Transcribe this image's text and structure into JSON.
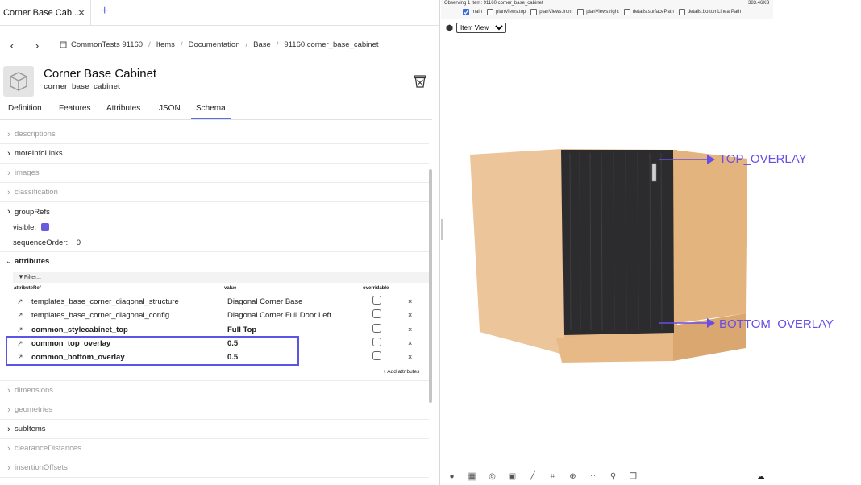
{
  "tab": {
    "title": "Corner Base Cab...",
    "close": "✕",
    "add": "+"
  },
  "breadcrumbs": [
    "CommonTests 91160",
    "Items",
    "Documentation",
    "Base",
    "91160.corner_base_cabinet"
  ],
  "item": {
    "title": "Corner Base Cabinet",
    "subtitle": "corner_base_cabinet"
  },
  "tabs": [
    "Definition",
    "Features",
    "Attributes",
    "JSON",
    "Schema"
  ],
  "active_tab": "Schema",
  "sections_top": [
    {
      "label": "descriptions",
      "state": "dim"
    },
    {
      "label": "moreInfoLinks",
      "state": "dark"
    },
    {
      "label": "images",
      "state": "dim"
    },
    {
      "label": "classification",
      "state": "dim"
    },
    {
      "label": "groupRefs",
      "state": "dark"
    }
  ],
  "visible_label": "visible:",
  "sequence": {
    "label": "sequenceOrder:",
    "value": "0"
  },
  "attributes_section": "attributes",
  "filter_placeholder": "Filter...",
  "columns": {
    "ref": "attributeRef",
    "value": "value",
    "overridable": "overridable"
  },
  "attributes": [
    {
      "ref": "templates_base_corner_diagonal_structure",
      "value": "Diagonal Corner Base",
      "bold": false
    },
    {
      "ref": "templates_base_corner_diagonal_config",
      "value": "Diagonal Corner Full Door Left",
      "bold": false
    },
    {
      "ref": "common_stylecabinet_top",
      "value": "Full Top",
      "bold": true
    },
    {
      "ref": "common_top_overlay",
      "value": "0.5",
      "bold": true
    },
    {
      "ref": "common_bottom_overlay",
      "value": "0.5",
      "bold": true
    }
  ],
  "remove_glyph": "×",
  "add_attributes": "+ Add attributes",
  "sections_bottom": [
    {
      "label": "dimensions",
      "state": "dim"
    },
    {
      "label": "geometries",
      "state": "dim"
    },
    {
      "label": "subItems",
      "state": "dark"
    },
    {
      "label": "clearanceDistances",
      "state": "dim"
    },
    {
      "label": "insertionOffsets",
      "state": "dim"
    }
  ],
  "viewer": {
    "observing": "Observing 1 item: 91160.corner_base_cabinet",
    "size": "383.46KB",
    "options": [
      {
        "label": "main",
        "checked": true
      },
      {
        "label": "planViews.top",
        "checked": false
      },
      {
        "label": "planViews.front",
        "checked": false
      },
      {
        "label": "planViews.right",
        "checked": false
      },
      {
        "label": "details.surfacePath",
        "checked": false
      },
      {
        "label": "details.bottomLinearPath",
        "checked": false
      }
    ],
    "view_select": "Item View",
    "annotations": {
      "top": "TOP_OVERLAY",
      "bottom": "BOTTOM_OVERLAY"
    }
  },
  "colors": {
    "accent": "#5b6ee1",
    "highlight": "#5b55e6",
    "annotation": "#6a4ce8",
    "wood": "#e9bf8d",
    "door": "#2c2c2e"
  }
}
